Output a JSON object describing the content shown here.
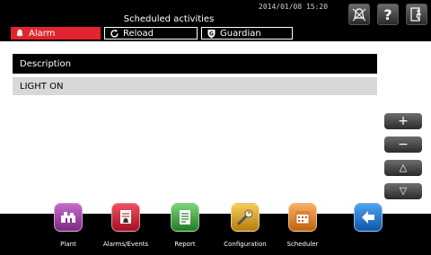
{
  "header": {
    "title": "Scheduled activities",
    "datetime": "2014/01/08 15:20"
  },
  "tabs": [
    {
      "label": "Alarm",
      "color": "#e2242f"
    },
    {
      "label": "Reload"
    },
    {
      "label": "Guardian"
    }
  ],
  "table": {
    "header": "Description",
    "rows": [
      "LIGHT ON"
    ]
  },
  "side_buttons": [
    "+",
    "−",
    "△",
    "▽"
  ],
  "bottom_nav": [
    {
      "label": "Plant",
      "icon": "plant-icon",
      "color": "#a23fa8"
    },
    {
      "label": "Alarms/Events",
      "icon": "alarms-events-icon",
      "color": "#d21e36"
    },
    {
      "label": "Report",
      "icon": "report-icon",
      "color": "#3aa23a"
    },
    {
      "label": "Configuration",
      "icon": "configuration-icon",
      "color": "#e0a51c"
    },
    {
      "label": "Scheduler",
      "icon": "scheduler-icon",
      "color": "#e98b2b"
    },
    {
      "label": "",
      "icon": "back-arrow-icon",
      "color": "#1f78d6"
    }
  ]
}
